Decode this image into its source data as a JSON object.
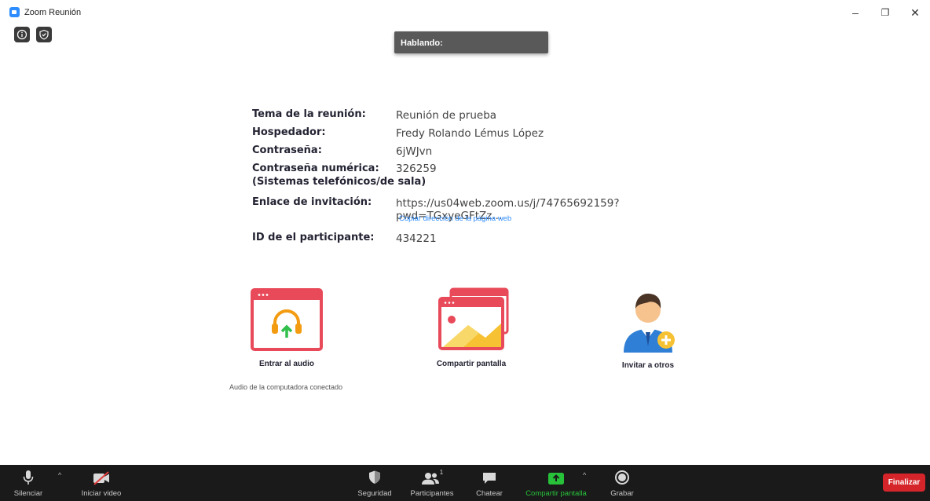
{
  "window": {
    "title": "Zoom Reunión",
    "minimize": "–",
    "restore": "❐",
    "close": "✕"
  },
  "speaking_banner": "Hablando:",
  "meeting": {
    "topic_label": "Tema de la reunión:",
    "topic": "Reunión de prueba",
    "host_label": "Hospedador:",
    "host": "Fredy Rolando Lémus López",
    "password_label": "Contraseña:",
    "password": "6jWJvn",
    "numeric_password_label": "Contraseña numérica:",
    "numeric_password_sublabel": "(Sistemas telefónicos/de sala)",
    "numeric_password": "326259",
    "invite_label": "Enlace de invitación:",
    "invite_link": "https://us04web.zoom.us/j/74765692159?pwd=TGxyeGFtZz...",
    "copy_link": "Copiar dirección de la página web",
    "participant_id_label": "ID de el participante:",
    "participant_id": "434221"
  },
  "actions": {
    "audio": "Entrar al audio",
    "audio_status": "Audio de la computadora conectado",
    "share": "Compartir pantalla",
    "invite": "Invitar a otros"
  },
  "toolbar": {
    "mute": "Silenciar",
    "video": "Iniciar video",
    "security": "Seguridad",
    "participants": "Participantes",
    "participants_count": "1",
    "chat": "Chatear",
    "share": "Compartir pantalla",
    "record": "Grabar",
    "end": "Finalizar"
  },
  "colors": {
    "accent_blue": "#2d8cff",
    "share_green": "#27c23a",
    "end_red": "#d6252a",
    "toolbar_bg": "#1a1a1a"
  }
}
